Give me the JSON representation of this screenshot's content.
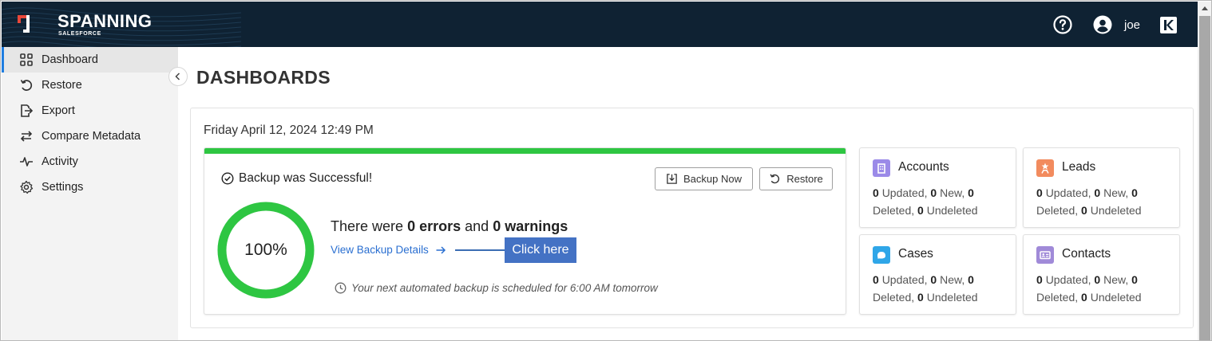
{
  "header": {
    "brand": "SPANNING",
    "brand_sub": "SALESFORCE",
    "user": "joe",
    "icons": [
      "help-icon",
      "user-avatar-icon",
      "k-app-icon"
    ],
    "bg_color": "#0f2233"
  },
  "sidebar": {
    "items": [
      {
        "label": "Dashboard",
        "icon": "dashboard-grid-icon",
        "active": true
      },
      {
        "label": "Restore",
        "icon": "restore-icon",
        "active": false
      },
      {
        "label": "Export",
        "icon": "export-icon",
        "active": false
      },
      {
        "label": "Compare Metadata",
        "icon": "compare-arrows-icon",
        "active": false
      },
      {
        "label": "Activity",
        "icon": "activity-pulse-icon",
        "active": false
      },
      {
        "label": "Settings",
        "icon": "gear-icon",
        "active": false
      }
    ],
    "active_color": "#1f7de0"
  },
  "main": {
    "title": "DASHBOARDS",
    "date": "Friday April 12, 2024 12:49 PM",
    "backup": {
      "status": "Backup was Successful!",
      "progress_percent": 100,
      "progress_label": "100%",
      "errors_prefix": "There were",
      "errors_count": "0 errors",
      "errors_mid": "and",
      "warnings_count": "0 warnings",
      "details_link": "View Backup Details",
      "callout": "Click here",
      "schedule": "Your next automated backup is scheduled for 6:00 AM tomorrow",
      "backup_now_label": "Backup Now",
      "restore_label": "Restore",
      "success_color": "#2ec642"
    },
    "objects": [
      {
        "title": "Accounts",
        "icon": "accounts-building-icon",
        "color": "#9b8ae8",
        "updated": "0",
        "new": "0",
        "deleted": "0",
        "undeleted": "0"
      },
      {
        "title": "Leads",
        "icon": "leads-star-person-icon",
        "color": "#f28b5e",
        "updated": "0",
        "new": "0",
        "deleted": "0",
        "undeleted": "0"
      },
      {
        "title": "Cases",
        "icon": "cases-briefcase-icon",
        "color": "#2fa6e8",
        "updated": "0",
        "new": "0",
        "deleted": "0",
        "undeleted": "0"
      },
      {
        "title": "Contacts",
        "icon": "contacts-card-icon",
        "color": "#a08ad8",
        "updated": "0",
        "new": "0",
        "deleted": "0",
        "undeleted": "0"
      }
    ],
    "stat_labels": {
      "updated": "Updated,",
      "new": "New,",
      "deleted": "Deleted,",
      "undeleted": "Undeleted"
    }
  }
}
